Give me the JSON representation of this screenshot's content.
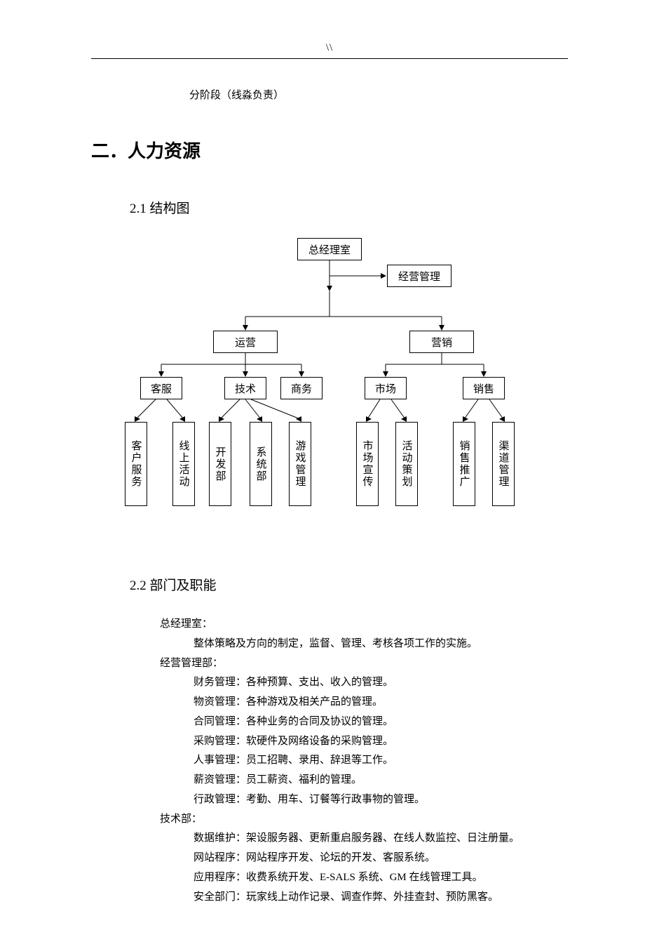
{
  "header_mark": "\\\\",
  "top_note": "分阶段（线淼负责）",
  "section_heading": "二．人力资源",
  "sub_21": "2.1  结构图",
  "sub_22": "2.2 部门及职能",
  "org": {
    "top": "总经理室",
    "mgmt": "经营管理",
    "ops": "运营",
    "mkt": "营销",
    "cs": "客服",
    "tech": "技术",
    "biz": "商务",
    "market": "市场",
    "sales": "销售",
    "l_cs1": "客户服务",
    "l_cs2": "线上活动",
    "l_t1": "开发部",
    "l_t2": "系统部",
    "l_t3": "游戏管理",
    "l_m1": "市场宣传",
    "l_m2": "活动策划",
    "l_s1": "销售推广",
    "l_s2": "渠道管理"
  },
  "body": {
    "gm_title": "总经理室：",
    "gm_1": "整体策略及方向的制定，监督、管理、考核各项工作的实施。",
    "mgmt_title": "经营管理部：",
    "mgmt_1": "财务管理：各种预算、支出、收入的管理。",
    "mgmt_2": "物资管理：各种游戏及相关产品的管理。",
    "mgmt_3": "合同管理：各种业务的合同及协议的管理。",
    "mgmt_4": "采购管理：软硬件及网络设备的采购管理。",
    "mgmt_5": "人事管理：员工招聘、录用、辞退等工作。",
    "mgmt_6": "薪资管理：员工薪资、福利的管理。",
    "mgmt_7": "行政管理：考勤、用车、订餐等行政事物的管理。",
    "tech_title": "技术部：",
    "tech_1": "数据维护：架设服务器、更新重启服务器、在线人数监控、日注册量。",
    "tech_2": "网站程序：网站程序开发、论坛的开发、客服系统。",
    "tech_3": "应用程序：收费系统开发、E-SALS 系统、GM 在线管理工具。",
    "tech_4": "安全部门：玩家线上动作记录、调查作弊、外挂查封、预防黑客。"
  }
}
